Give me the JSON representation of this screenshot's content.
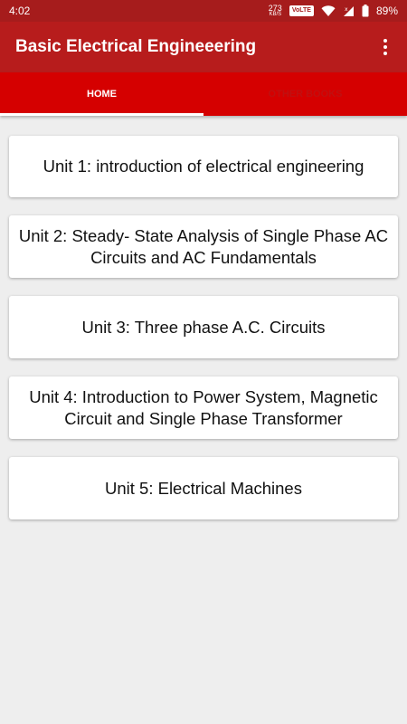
{
  "status_bar": {
    "time": "4:02",
    "speed_value": "273",
    "speed_unit": "KB/S",
    "volte": "VoLTE",
    "battery": "89%"
  },
  "app_bar": {
    "title": "Basic Electrical Engineeering"
  },
  "tabs": [
    {
      "label": "HOME",
      "selected": true
    },
    {
      "label": "OTHER BOOKS",
      "selected": false
    }
  ],
  "units": [
    {
      "label": "Unit 1: introduction of electrical engineering"
    },
    {
      "label": "Unit 2: Steady- State Analysis of Single Phase AC Circuits and AC Fundamentals"
    },
    {
      "label": "Unit 3: Three phase A.C. Circuits"
    },
    {
      "label": "Unit 4: Introduction to Power System, Magnetic Circuit and Single Phase Transformer"
    },
    {
      "label": "Unit 5: Electrical Machines"
    }
  ],
  "colors": {
    "status_bar": "#a61c1c",
    "app_bar": "#b71c1c",
    "tab_bar": "#d50000",
    "background": "#eeeeee"
  }
}
